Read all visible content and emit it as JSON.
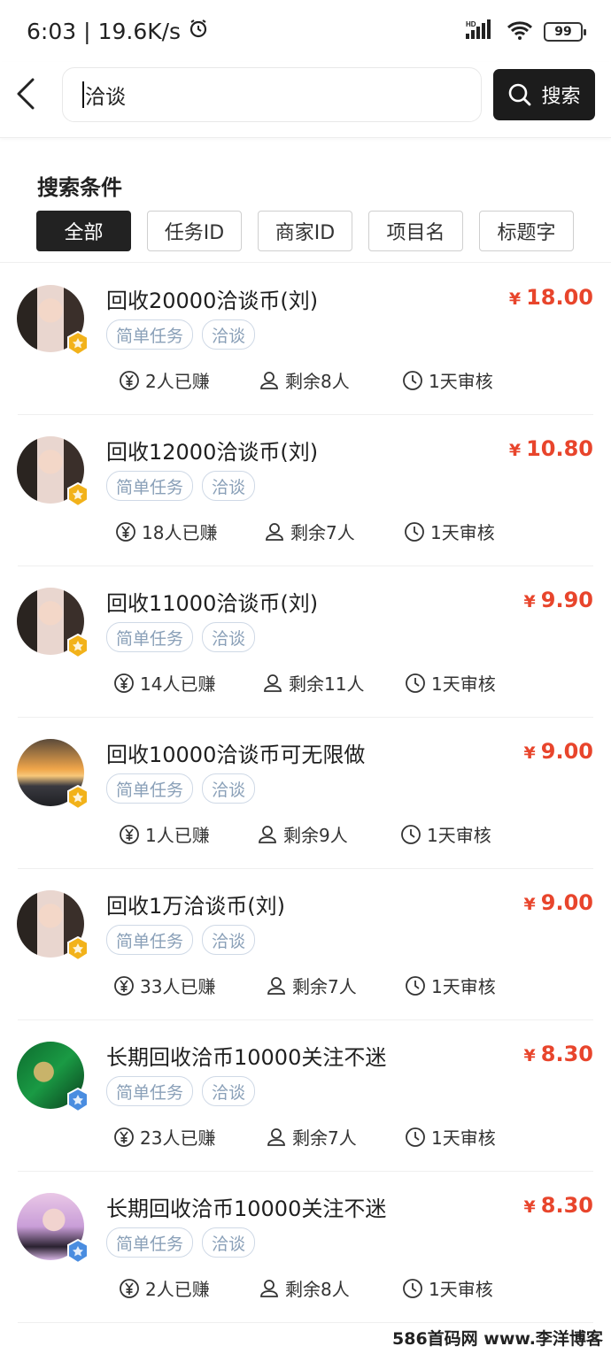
{
  "status_bar": {
    "time": "6:03",
    "speed": "19.6K/s",
    "network": "HD",
    "battery": "99"
  },
  "search": {
    "query": "洽谈",
    "button_label": "搜索"
  },
  "filters": {
    "title": "搜索条件",
    "chips": [
      "全部",
      "任务ID",
      "商家ID",
      "项目名",
      "标题字"
    ]
  },
  "tasks": [
    {
      "title": "回收20000洽谈币(刘)",
      "price": "18.00",
      "tags": [
        "简单任务",
        "洽谈"
      ],
      "earned": "2人已赚",
      "remaining": "剩余8人",
      "review": "1天审核",
      "avatar": "woman-portrait",
      "badge": "gold"
    },
    {
      "title": "回收12000洽谈币(刘)",
      "price": "10.80",
      "tags": [
        "简单任务",
        "洽谈"
      ],
      "earned": "18人已赚",
      "remaining": "剩余7人",
      "review": "1天审核",
      "avatar": "woman-portrait",
      "badge": "gold"
    },
    {
      "title": "回收11000洽谈币(刘)",
      "price": "9.90",
      "tags": [
        "简单任务",
        "洽谈"
      ],
      "earned": "14人已赚",
      "remaining": "剩余11人",
      "review": "1天审核",
      "avatar": "woman-portrait",
      "badge": "gold"
    },
    {
      "title": "回收10000洽谈币可无限做",
      "price": "9.00",
      "tags": [
        "简单任务",
        "洽谈"
      ],
      "earned": "1人已赚",
      "remaining": "剩余9人",
      "review": "1天审核",
      "avatar": "sunset-silhouette",
      "badge": "gold"
    },
    {
      "title": "回收1万洽谈币(刘)",
      "price": "9.00",
      "tags": [
        "简单任务",
        "洽谈"
      ],
      "earned": "33人已赚",
      "remaining": "剩余7人",
      "review": "1天审核",
      "avatar": "woman-portrait",
      "badge": "gold"
    },
    {
      "title": "长期回收洽币10000关注不迷",
      "price": "8.30",
      "tags": [
        "简单任务",
        "洽谈"
      ],
      "earned": "23人已赚",
      "remaining": "剩余7人",
      "review": "1天审核",
      "avatar": "green-boxes",
      "badge": "blue"
    },
    {
      "title": "长期回收洽币10000关注不迷",
      "price": "8.30",
      "tags": [
        "简单任务",
        "洽谈"
      ],
      "earned": "2人已赚",
      "remaining": "剩余8人",
      "review": "1天审核",
      "avatar": "woman-pink",
      "badge": "blue"
    }
  ],
  "currency_symbol": "¥",
  "watermark": "586首码网 www.李洋博客",
  "colors": {
    "price": "#e8452c",
    "tag_text": "#8aa0b8",
    "active_chip": "#222222"
  }
}
